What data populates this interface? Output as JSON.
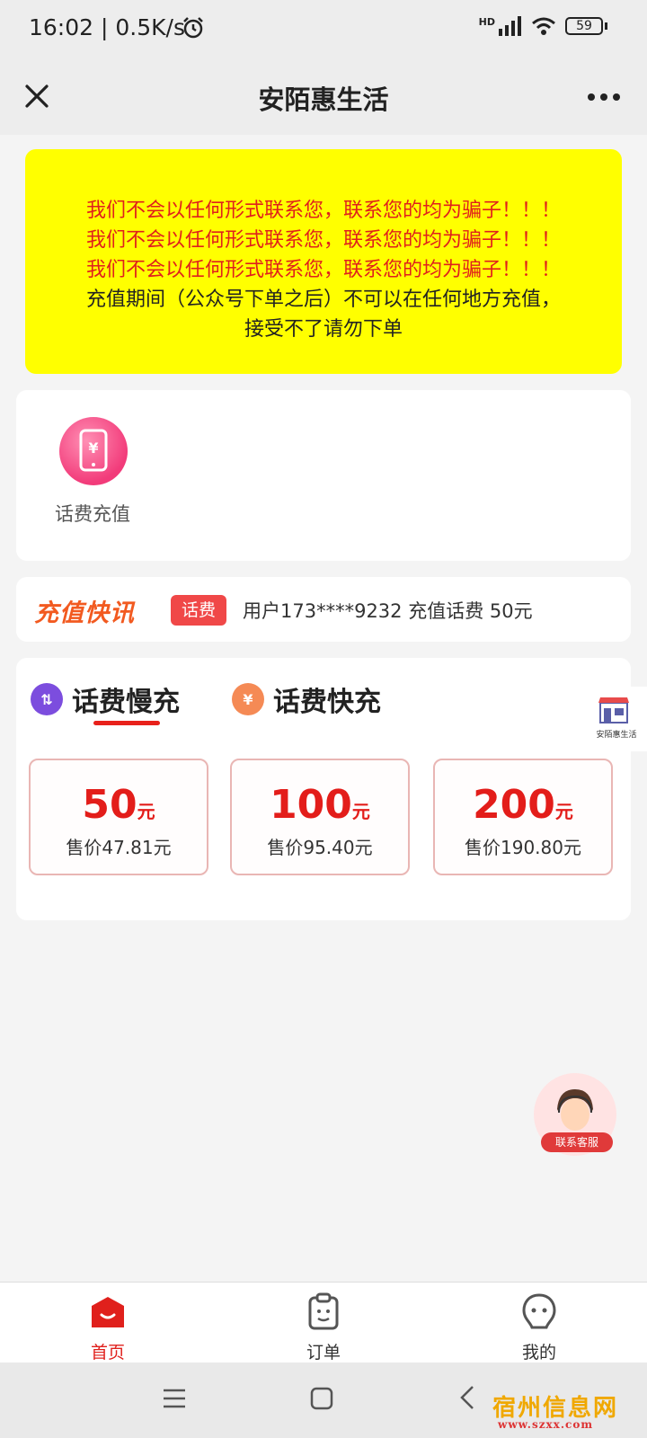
{
  "status": {
    "time": "16:02 | 0.5K/s",
    "network": "HD",
    "battery": "59"
  },
  "titlebar": {
    "title": "安陌惠生活"
  },
  "notice": {
    "warning_line": "我们不会以任何形式联系您，联系您的均为骗子！！！",
    "info_line1": "充值期间（公众号下单之后）不可以在任何地方充值，",
    "info_line2": "接受不了请勿下单"
  },
  "services": [
    {
      "label": "话费充值"
    }
  ],
  "news": {
    "logo": "充值快讯",
    "badge": "话费",
    "text": "用户173****9232 充值话费 50元"
  },
  "tabs": [
    {
      "label": "话费慢充",
      "active": true
    },
    {
      "label": "话费快充",
      "active": false
    }
  ],
  "options": [
    {
      "amount": "50",
      "unit": "元",
      "price": "售价47.81元"
    },
    {
      "amount": "100",
      "unit": "元",
      "price": "售价95.40元"
    },
    {
      "amount": "200",
      "unit": "元",
      "price": "售价190.80元"
    }
  ],
  "floating": {
    "shop_logo_text": "安陌惠生活",
    "service_label": "联系客服"
  },
  "bottom_nav": [
    {
      "label": "首页",
      "active": true
    },
    {
      "label": "订单",
      "active": false
    },
    {
      "label": "我的",
      "active": false
    }
  ],
  "watermark": {
    "text": "宿州信息网",
    "url": "www.szxx.com"
  },
  "colors": {
    "accent": "#e31d1a",
    "notice_bg": "#ffff00",
    "warning_text": "#e0201c"
  }
}
